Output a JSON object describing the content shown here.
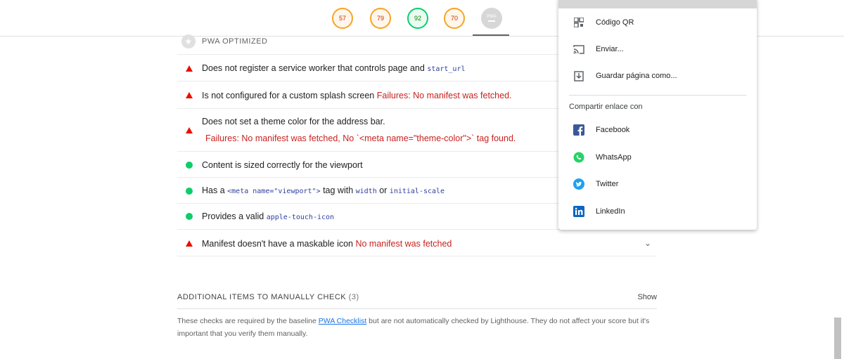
{
  "scores": [
    {
      "value": "57",
      "status": "average"
    },
    {
      "value": "79",
      "status": "average"
    },
    {
      "value": "92",
      "status": "pass"
    },
    {
      "value": "70",
      "status": "average"
    },
    {
      "value": "PWA",
      "status": "neutral"
    }
  ],
  "section": {
    "title": "PWA OPTIMIZED"
  },
  "audits": {
    "a1": {
      "text": "Does not register a service worker that controls page and ",
      "code": "start_url"
    },
    "a2": {
      "text": "Is not configured for a custom splash screen ",
      "fail": "Failures: No manifest was fetched."
    },
    "a3": {
      "text": "Does not set a theme color for the address bar.",
      "fail": "Failures: No manifest was fetched, No `<meta name=\"theme-color\">` tag found."
    },
    "a4": {
      "text": "Content is sized correctly for the viewport"
    },
    "a5": {
      "pre": "Has a ",
      "code1": "<meta name=\"viewport\">",
      "mid1": " tag with ",
      "code2": "width",
      "mid2": " or ",
      "code3": "initial-scale"
    },
    "a6": {
      "text": "Provides a valid ",
      "code": "apple-touch-icon"
    },
    "a7": {
      "text": "Manifest doesn't have a maskable icon ",
      "fail": "No manifest was fetched"
    }
  },
  "manual": {
    "title": "ADDITIONAL ITEMS TO MANUALLY CHECK",
    "count": "(3)",
    "show": "Show",
    "desc_pre": "These checks are required by the baseline ",
    "link": "PWA Checklist",
    "desc_post": " but are not automatically checked by Lighthouse. They do not affect your score but it's important that you verify them manually."
  },
  "menu": {
    "items": [
      {
        "label": "Código QR",
        "icon": "qr-code-icon"
      },
      {
        "label": "Enviar...",
        "icon": "cast-icon"
      },
      {
        "label": "Guardar página como...",
        "icon": "save-page-icon"
      }
    ],
    "share_title": "Compartir enlace con",
    "share": [
      {
        "label": "Facebook",
        "icon": "facebook-icon",
        "color": "#3b5998"
      },
      {
        "label": "WhatsApp",
        "icon": "whatsapp-icon",
        "color": "#25d366"
      },
      {
        "label": "Twitter",
        "icon": "twitter-icon",
        "color": "#1da1f2"
      },
      {
        "label": "LinkedIn",
        "icon": "linkedin-icon",
        "color": "#0a66c2"
      }
    ]
  },
  "colors": {
    "fail": "#eb0f00",
    "pass": "#0cce6b",
    "average": "#f5a623"
  }
}
